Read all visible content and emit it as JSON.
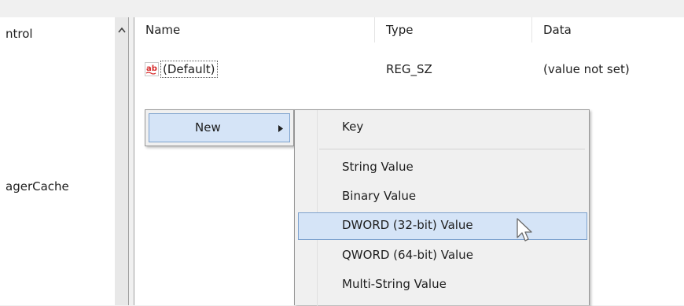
{
  "tree": {
    "items": [
      {
        "label": "ntrol"
      },
      {
        "label": "agerCache"
      }
    ]
  },
  "list": {
    "columns": {
      "name": "Name",
      "type": "Type",
      "data": "Data"
    },
    "rows": [
      {
        "name": "(Default)",
        "type": "REG_SZ",
        "data": "(value not set)",
        "icon": "string-value-ab-icon"
      }
    ]
  },
  "context_menu": {
    "new_label": "New"
  },
  "submenu": {
    "items": [
      {
        "label": "Key"
      },
      {
        "label": "String Value"
      },
      {
        "label": "Binary Value"
      },
      {
        "label": "DWORD (32-bit) Value"
      },
      {
        "label": "QWORD (64-bit) Value"
      },
      {
        "label": "Multi-String Value"
      }
    ]
  },
  "colors": {
    "menu_highlight": "#d5e4f7",
    "menu_highlight_border": "#7da2ce",
    "ab_icon_red": "#d62b2b"
  }
}
